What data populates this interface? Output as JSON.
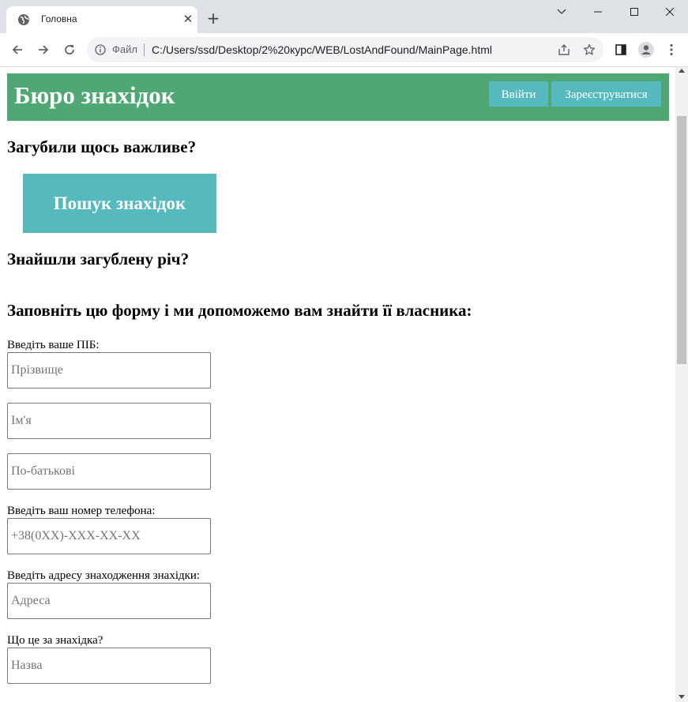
{
  "browser": {
    "tab_title": "Головна",
    "file_label": "Файл",
    "url": "C:/Users/ssd/Desktop/2%20курс/WEB/LostAndFound/MainPage.html"
  },
  "header": {
    "title": "Бюро знахідок",
    "login_label": "Ввійти",
    "register_label": "Зареєструватися"
  },
  "main": {
    "lost_heading": "Загубили щось важливе?",
    "search_button_label": "Пошук знахідок",
    "found_heading": "Знайшли загублену річ?",
    "form_heading": "Заповніть цю форму і ми допоможемо вам знайти її власника:"
  },
  "form": {
    "name_label": "Введіть ваше ПІБ:",
    "surname_placeholder": "Прізвище",
    "firstname_placeholder": "Ім'я",
    "patronymic_placeholder": "По-батькові",
    "phone_label": "Введіть ваш номер телефона:",
    "phone_placeholder": "+38(0XX)-XXX-XX-XX",
    "address_label": "Введіть адресу знаходження знахідки:",
    "address_placeholder": "Адреса",
    "item_label": "Що це за знахідка?",
    "item_placeholder": "Назва"
  },
  "colors": {
    "header_bg": "#4fa773",
    "button_bg": "#56b9bd"
  }
}
